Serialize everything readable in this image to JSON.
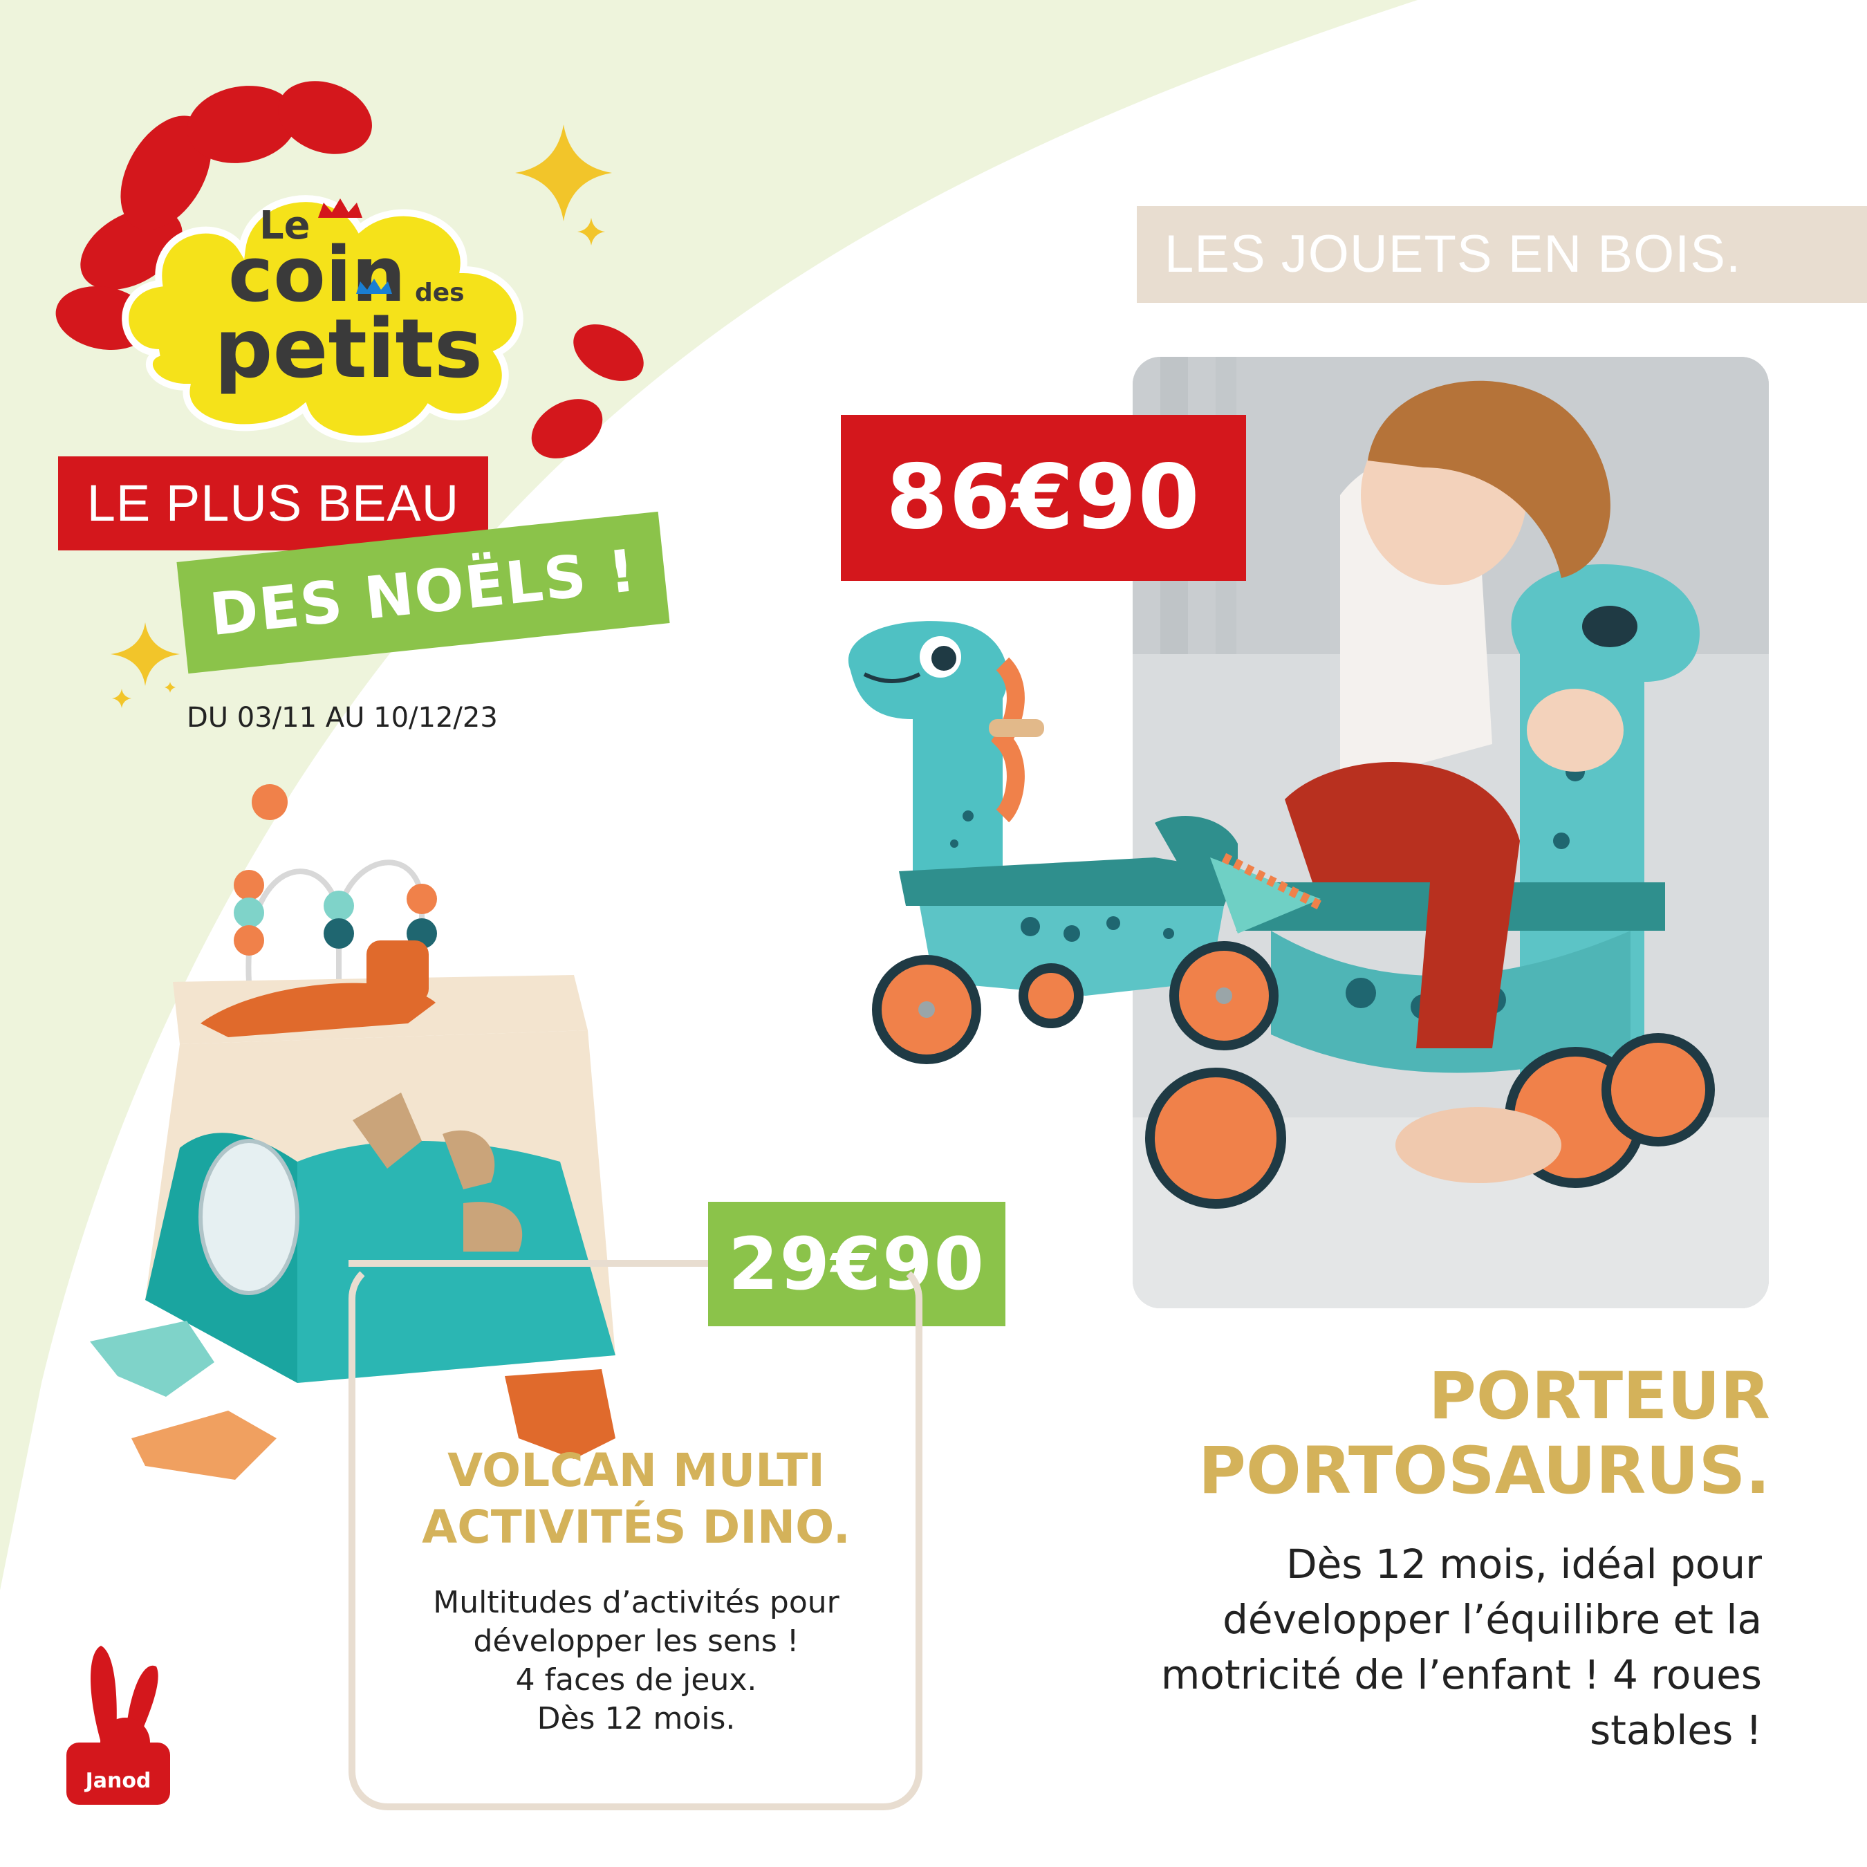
{
  "colors": {
    "red": "#d4171c",
    "green": "#8bc34a",
    "gold": "#d4b25a",
    "beige": "#e8ddd0",
    "pale_green_background": "#eef4dc",
    "logo_yellow": "#f5e21a"
  },
  "logo": {
    "line1": "Le",
    "line2": "coin",
    "line3": "des",
    "line4": "petits"
  },
  "headline": {
    "line1": "LE PLUS BEAU",
    "line2": "DES NOËLS !",
    "dates": "DU 03/11 AU 10/12/23"
  },
  "category": "LES JOUETS EN BOIS.",
  "products": [
    {
      "price": "86€90",
      "title": "PORTEUR PORTOSAURUS.",
      "description": "Dès 12 mois, idéal pour développer l’équilibre et la motricité de l’enfant ! 4 roues stables !",
      "image": "wooden-dinosaur-ride-on-toy",
      "photo": "child-on-dinosaur-ride-on-photo"
    },
    {
      "price": "29€90",
      "title": "VOLCAN MULTI ACTIVITÉS DINO.",
      "description": "Multitudes d’activités pour\ndévelopper les sens !\n4 faces de jeux.\nDès 12 mois.",
      "image": "wooden-activity-cube-toy"
    }
  ],
  "brand": {
    "name": "Janod",
    "icon": "rabbit-icon"
  }
}
